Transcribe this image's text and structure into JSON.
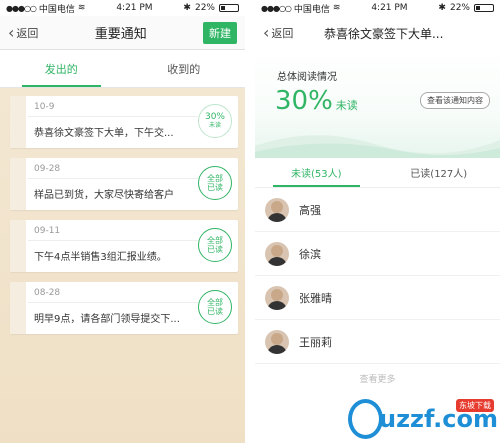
{
  "status_bar": {
    "carrier": "中国电信",
    "time": "4:21 PM",
    "battery": "22%"
  },
  "left": {
    "back_label": "返回",
    "title": "重要通知",
    "new_label": "新建",
    "tabs": [
      "发出的",
      "收到的"
    ],
    "cards": [
      {
        "date": "10-9",
        "text": "恭喜徐文豪签下大单，下午交...",
        "badge_main": "30%",
        "badge_sub": "未读"
      },
      {
        "date": "09-28",
        "text": "样品已到货，大家尽快寄给客户",
        "badge_main": "全部",
        "badge_sub": "已读"
      },
      {
        "date": "09-11",
        "text": "下午4点半销售3组汇报业绩。",
        "badge_main": "全部",
        "badge_sub": "已读"
      },
      {
        "date": "08-28",
        "text": "明早9点，请各部门领导提交下...",
        "badge_main": "全部",
        "badge_sub": "已读"
      }
    ]
  },
  "right": {
    "back_label": "返回",
    "title": "恭喜徐文豪签下大单...",
    "summary_label": "总体阅读情况",
    "percent": "30%",
    "percent_label": "未读",
    "view_button": "查看该通知内容",
    "tabs": [
      "未读(53人)",
      "已读(127人)"
    ],
    "people": [
      "高强",
      "徐滨",
      "张雅晴",
      "王丽莉"
    ],
    "more": "查看更多"
  },
  "watermark": {
    "text": "uzzf.com",
    "tag": "东坡下载"
  },
  "colors": {
    "accent": "#30b565",
    "wood": "#f3e7d2"
  }
}
